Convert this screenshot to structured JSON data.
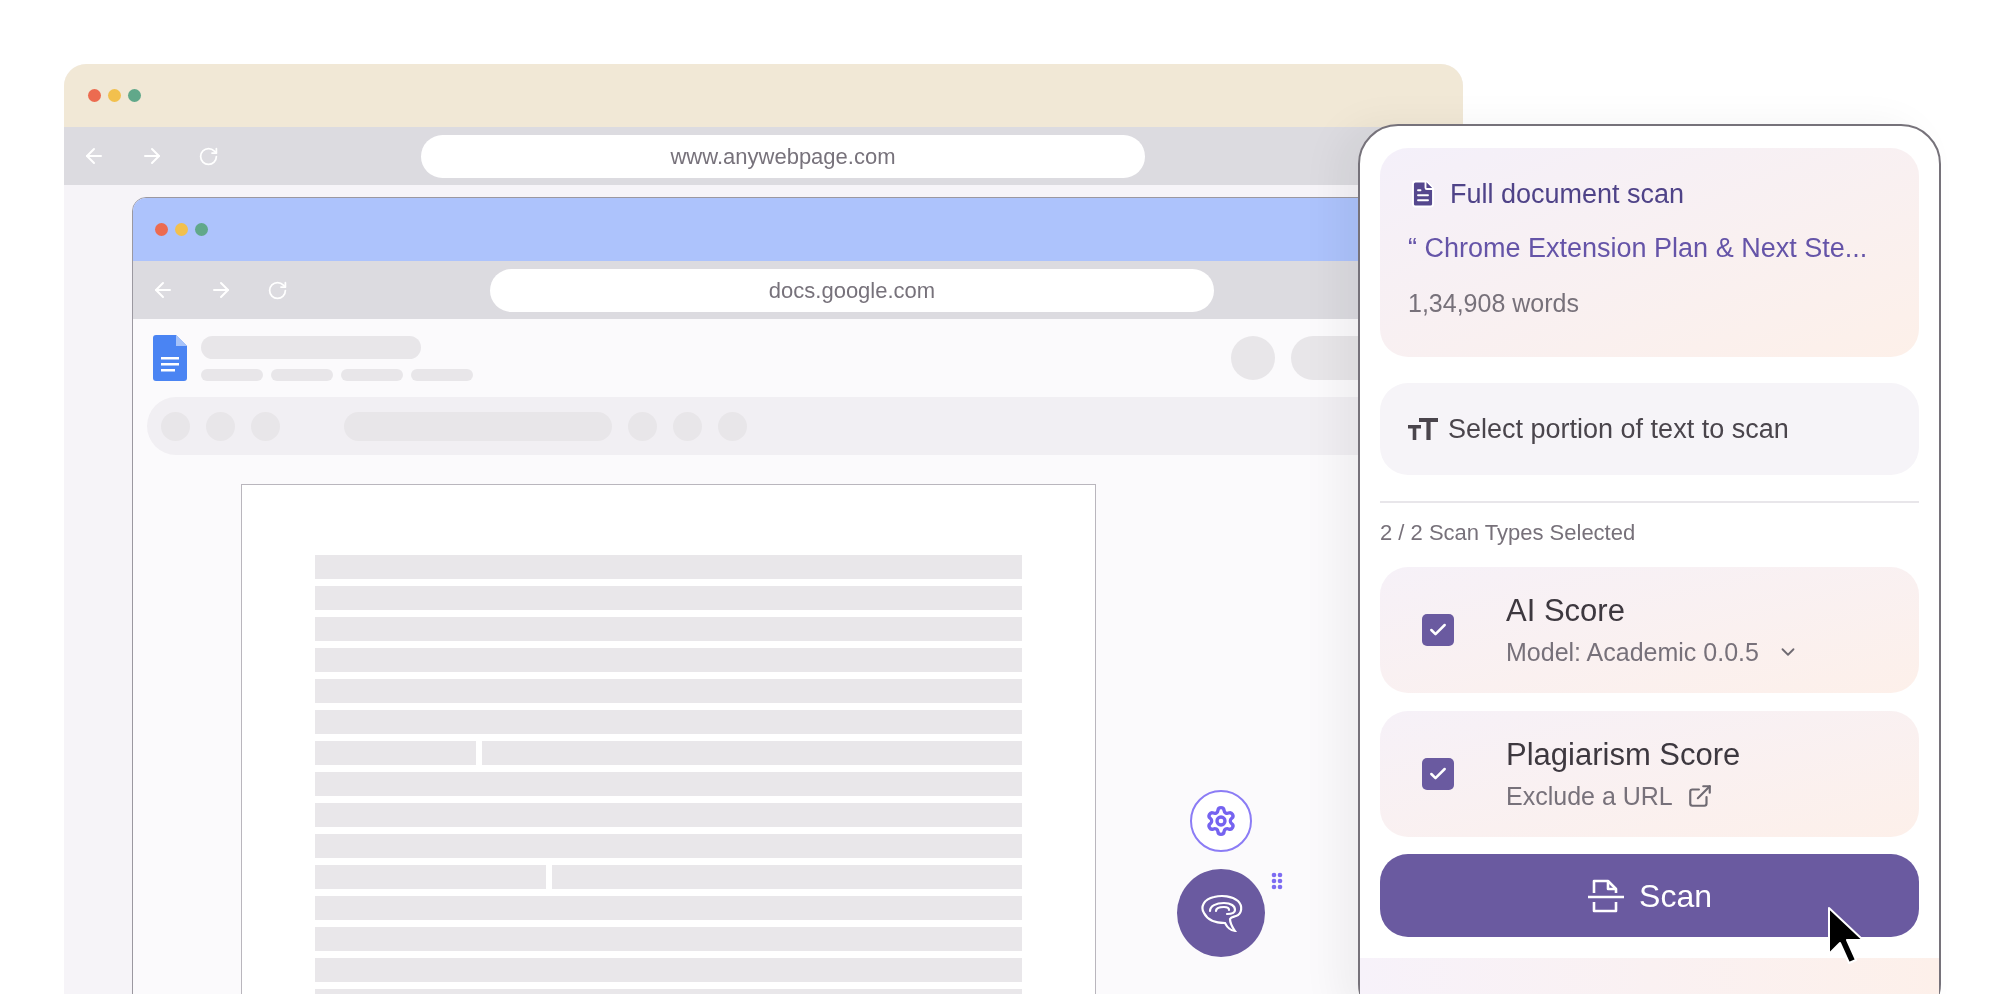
{
  "outer_browser": {
    "url": "www.anywebpage.com"
  },
  "inner_browser": {
    "url": "docs.google.com"
  },
  "panel": {
    "document_card": {
      "title": "Full document scan",
      "document_title": "“ Chrome Extension Plan & Next Ste...",
      "word_count": "1,34,908 words"
    },
    "selection_card": {
      "label": "Select portion of text to scan"
    },
    "scan_types_label": "2 / 2 Scan Types Selected",
    "scan_types": [
      {
        "kind": "dropdown",
        "title": "AI Score",
        "subtitle": "Model: Academic 0.0.5",
        "checked": true
      },
      {
        "kind": "link",
        "title": "Plagiarism Score",
        "subtitle": "Exclude a URL",
        "checked": true
      }
    ],
    "scan_button": "Scan"
  }
}
